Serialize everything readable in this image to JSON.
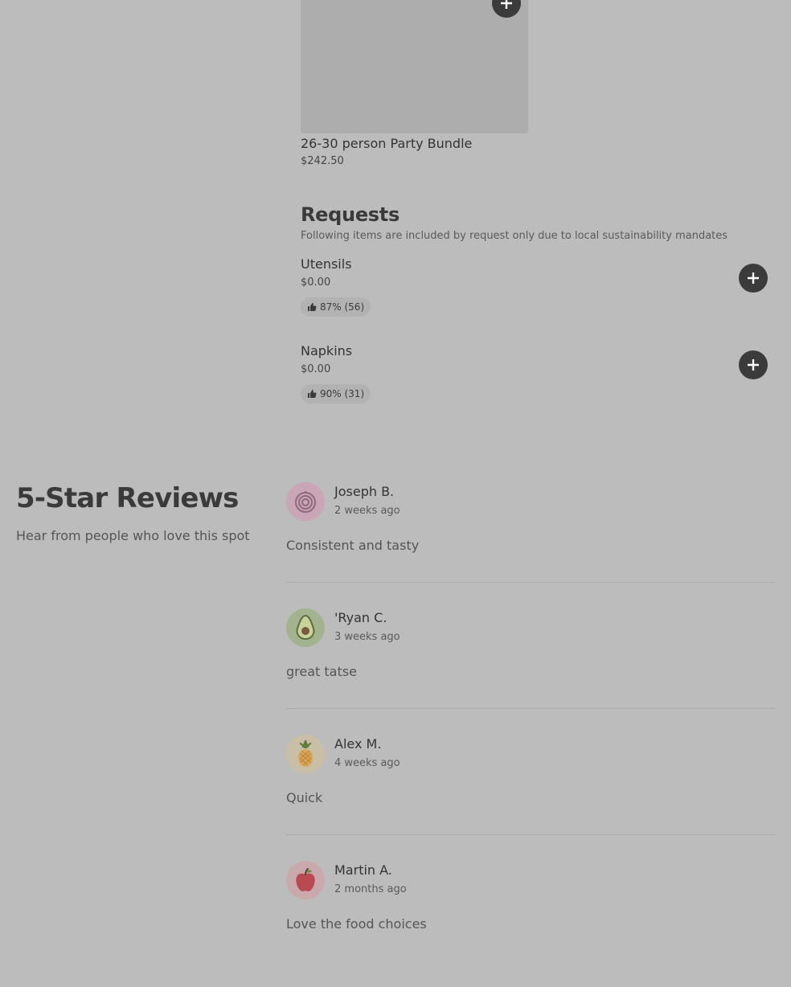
{
  "bundle": {
    "name": "26-30 person Party Bundle",
    "price": "$242.50"
  },
  "requests": {
    "title": "Requests",
    "subtitle": "Following items are included by request only due to local sustainability mandates",
    "items": [
      {
        "name": "Utensils",
        "price": "$0.00",
        "rating": "87% (56)"
      },
      {
        "name": "Napkins",
        "price": "$0.00",
        "rating": "90% (31)"
      }
    ]
  },
  "reviews": {
    "title": "5-Star Reviews",
    "subtitle": "Hear from people who love this spot",
    "items": [
      {
        "name": "Joseph B.",
        "time": "2 weeks ago",
        "text": "Consistent and tasty",
        "avatar_icon": "onion-icon",
        "avatar_bg": "#c8a6b6"
      },
      {
        "name": "'Ryan C.",
        "time": "3 weeks ago",
        "text": "great tatse",
        "avatar_icon": "avocado-icon",
        "avatar_bg": "#a3b390"
      },
      {
        "name": "Alex M.",
        "time": "4 weeks ago",
        "text": "Quick",
        "avatar_icon": "pineapple-icon",
        "avatar_bg": "#c9bfa6"
      },
      {
        "name": "Martin A.",
        "time": "2 months ago",
        "text": "Love the food choices",
        "avatar_icon": "apple-icon",
        "avatar_bg": "#c9a9ac"
      }
    ]
  },
  "colors": {
    "overlay_background": "#bcbcbc",
    "button": "#3b3b3b"
  }
}
